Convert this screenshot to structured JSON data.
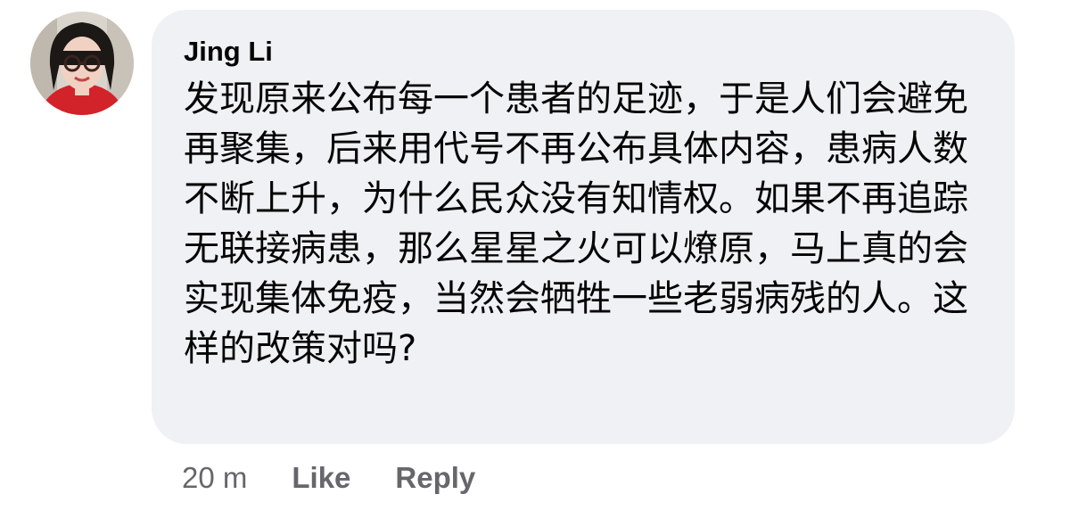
{
  "comment": {
    "author": "Jing Li",
    "text": "发现原来公布每一个患者的足迹，于是人们会避免再聚集，后来用代号不再公布具体内容，患病人数不断上升，为什么民众没有知情权。如果不再追踪无联接病患，那么星星之火可以燎原，马上真的会实现集体免疫，当然会牺牲一些老弱病残的人。这样的改策对吗?",
    "timestamp": "20 m",
    "like_label": "Like",
    "reply_label": "Reply"
  },
  "colors": {
    "bubble_background": "#eff1f4",
    "text_primary": "#050505",
    "text_secondary": "#65676b"
  }
}
